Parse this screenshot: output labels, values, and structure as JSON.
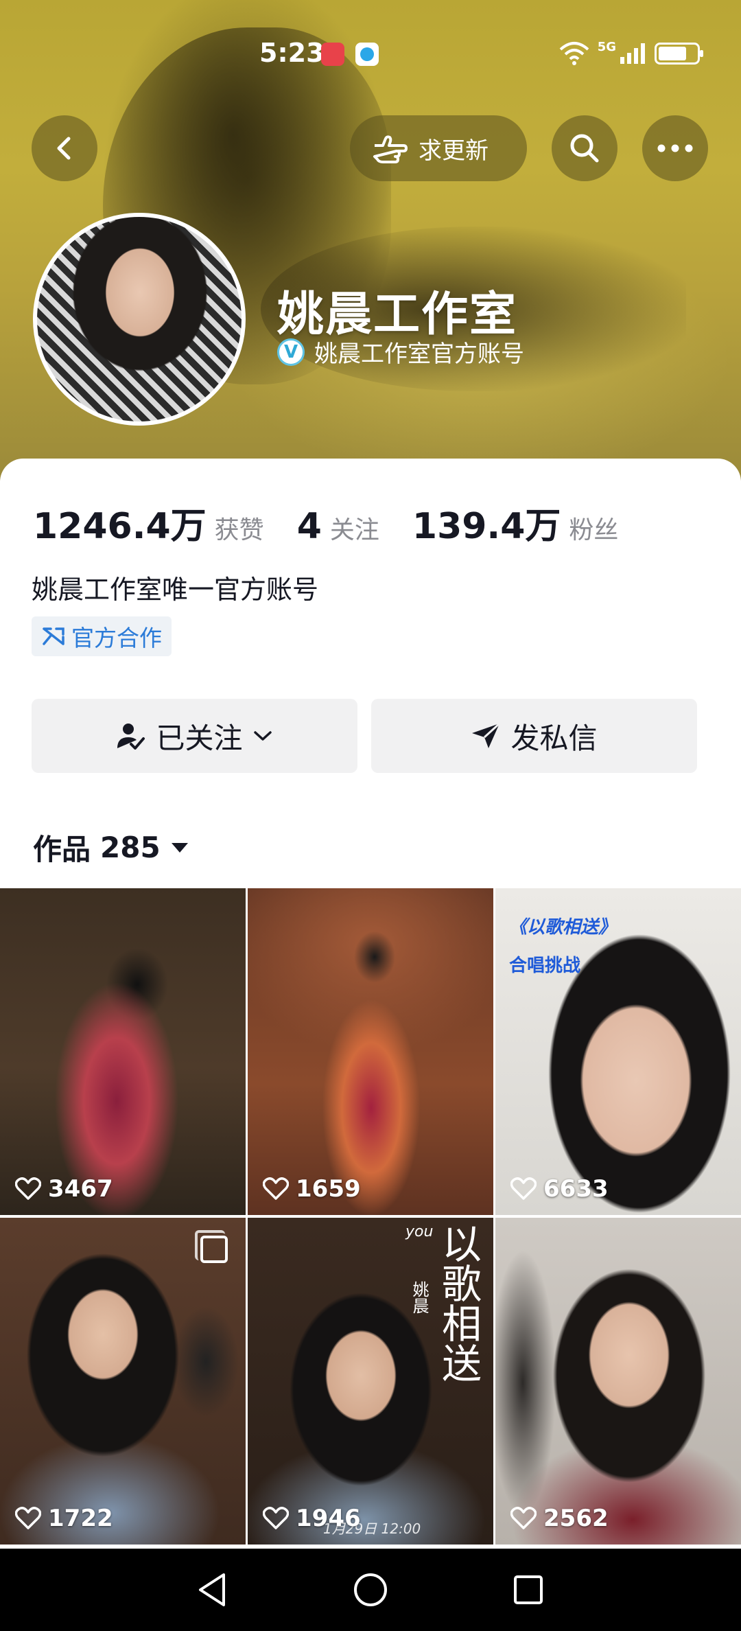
{
  "status_bar": {
    "time": "5:23",
    "network": "5G"
  },
  "header": {
    "request_button_label": "求更新",
    "profile_name": "姚晨工作室",
    "verified_text": "姚晨工作室官方账号"
  },
  "stats": [
    {
      "number": "1246.4万",
      "label": "获赞"
    },
    {
      "number": "4",
      "label": "关注"
    },
    {
      "number": "139.4万",
      "label": "粉丝"
    }
  ],
  "bio": "姚晨工作室唯一官方账号",
  "tag": "官方合作",
  "buttons": {
    "following_label": "已关注",
    "message_label": "发私信"
  },
  "works": {
    "label": "作品",
    "count": "285"
  },
  "videos": [
    {
      "likes": "3467"
    },
    {
      "likes": "1659"
    },
    {
      "likes": "6633",
      "overlay_title": "《以歌相送》",
      "overlay_subtitle": "合唱挑战"
    },
    {
      "likes": "1722"
    },
    {
      "likes": "1946",
      "overlay_title": "以歌相送",
      "overlay_name": "姚晨",
      "overlay_prefix": "you",
      "overlay_date": "1月29日 12:00"
    },
    {
      "likes": "2562"
    }
  ],
  "colors": {
    "accent_blue": "#2b7bd8",
    "verified": "#5fc3e4",
    "banner": "#c2ae3c"
  }
}
